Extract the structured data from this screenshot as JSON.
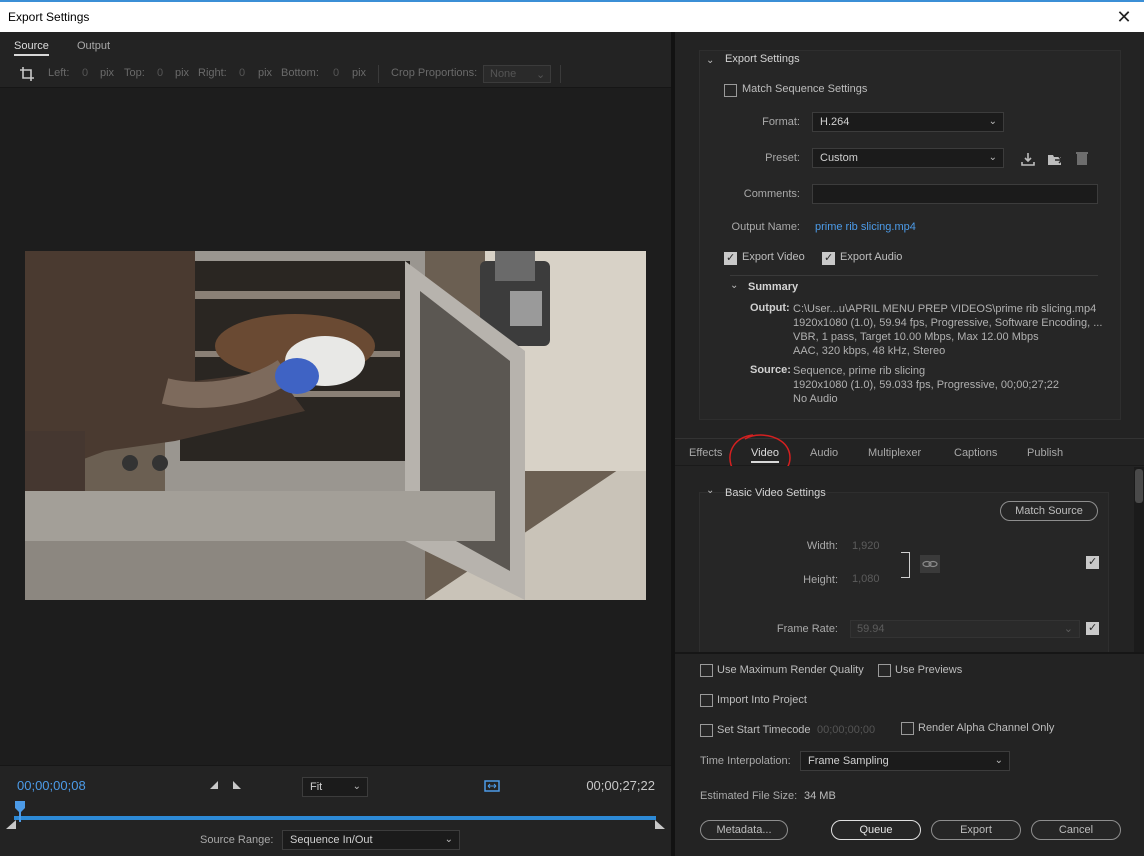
{
  "window": {
    "title": "Export Settings",
    "close_glyph": "✕"
  },
  "left": {
    "tabs": [
      {
        "label": "Source"
      },
      {
        "label": "Output"
      }
    ],
    "crop": {
      "left_label": "Left:",
      "left_val": "0",
      "px1": "pix",
      "top_label": "Top:",
      "top_val": "0",
      "px2": "pix",
      "right_label": "Right:",
      "right_val": "0",
      "px3": "pix",
      "bottom_label": "Bottom:",
      "bottom_val": "0",
      "px4": "pix",
      "proportions_label": "Crop Proportions:",
      "proportions_value": "None"
    },
    "timebar": {
      "current_timecode": "00;00;00;08",
      "end_timecode": "00;00;27;22",
      "fit_value": "Fit",
      "source_range_label": "Source Range:",
      "source_range_value": "Sequence In/Out"
    }
  },
  "right": {
    "export_settings": {
      "header": "Export Settings",
      "match_sequence": "Match Sequence Settings",
      "format_label": "Format:",
      "format_value": "H.264",
      "preset_label": "Preset:",
      "preset_value": "Custom",
      "comments_label": "Comments:",
      "comments_value": "",
      "output_name_label": "Output Name:",
      "output_name_value": "prime rib slicing.mp4",
      "export_video": "Export Video",
      "export_audio": "Export Audio",
      "summary_header": "Summary",
      "output_label": "Output:",
      "output_lines": [
        "C:\\User...u\\APRIL MENU PREP VIDEOS\\prime rib slicing.mp4",
        "1920x1080 (1.0), 59.94 fps, Progressive, Software Encoding, ...",
        "VBR, 1 pass, Target 10.00 Mbps, Max 12.00 Mbps",
        "AAC, 320 kbps, 48 kHz, Stereo"
      ],
      "source_label": "Source:",
      "source_lines": [
        "Sequence, prime rib slicing",
        "1920x1080 (1.0), 59.033 fps, Progressive, 00;00;27;22",
        "No Audio"
      ]
    },
    "tabs": [
      {
        "label": "Effects"
      },
      {
        "label": "Video"
      },
      {
        "label": "Audio"
      },
      {
        "label": "Multiplexer"
      },
      {
        "label": "Captions"
      },
      {
        "label": "Publish"
      }
    ],
    "basic_video": {
      "header": "Basic Video Settings",
      "match_source": "Match Source",
      "width_label": "Width:",
      "width_value": "1,920",
      "height_label": "Height:",
      "height_value": "1,080",
      "frame_rate_label": "Frame Rate:",
      "frame_rate_value": "59.94"
    },
    "bottom": {
      "max_render": "Use Maximum Render Quality",
      "use_previews": "Use Previews",
      "import_project": "Import Into Project",
      "set_start_tc": "Set Start Timecode",
      "start_tc_value": "00;00;00;00",
      "render_alpha": "Render Alpha Channel Only",
      "time_interp_label": "Time Interpolation:",
      "time_interp_value": "Frame Sampling",
      "file_size_label": "Estimated File Size:",
      "file_size_value": "34 MB",
      "metadata_btn": "Metadata...",
      "queue_btn": "Queue",
      "export_btn": "Export",
      "cancel_btn": "Cancel"
    }
  },
  "colors": {
    "accent": "#4c9be8",
    "annotation": "#d42020"
  }
}
